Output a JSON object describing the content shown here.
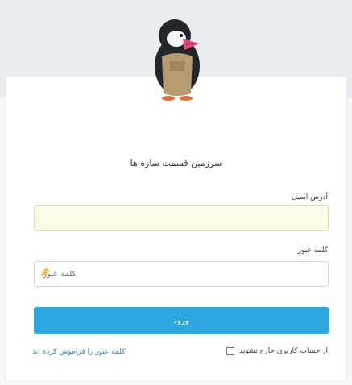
{
  "brand": {
    "logo_icon": "prestashop-puffin-icon"
  },
  "login": {
    "welcome_text": "سرزمین قسمت سازه ها",
    "email_label": "آدرس ایمیل",
    "email_value": "",
    "password_label": "کلمه عبور",
    "password_placeholder": "کلمه عبور",
    "submit_label": "ورود",
    "remember_label": "از حساب کاربری خارج نشوید",
    "forgot_link": "کلمه عبور را فراموش کرده اید"
  },
  "colors": {
    "accent": "#2ba6e1",
    "link": "#2a86c2",
    "email_bg": "#fbfbe6"
  }
}
